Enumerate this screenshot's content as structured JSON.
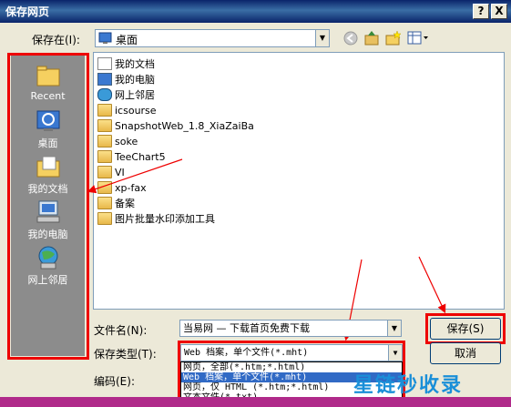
{
  "window": {
    "title": "保存网页",
    "help_glyph": "?",
    "close_glyph": "X"
  },
  "save_in": {
    "label": "保存在(I):",
    "value": "桌面"
  },
  "places": [
    {
      "label": "Recent",
      "icon": "recent-folder-icon"
    },
    {
      "label": "桌面",
      "icon": "desktop-icon"
    },
    {
      "label": "我的文档",
      "icon": "my-documents-icon"
    },
    {
      "label": "我的电脑",
      "icon": "my-computer-icon"
    },
    {
      "label": "网上邻居",
      "icon": "network-places-icon"
    }
  ],
  "files": [
    {
      "name": "我的文档",
      "icon": "my-documents-icon"
    },
    {
      "name": "我的电脑",
      "icon": "my-computer-icon"
    },
    {
      "name": "网上邻居",
      "icon": "network-places-icon"
    },
    {
      "name": "icsourse",
      "icon": "folder-icon"
    },
    {
      "name": "SnapshotWeb_1.8_XiaZaiBa",
      "icon": "folder-icon"
    },
    {
      "name": "soke",
      "icon": "folder-icon"
    },
    {
      "name": "TeeChart5",
      "icon": "folder-icon"
    },
    {
      "name": "VI",
      "icon": "folder-icon"
    },
    {
      "name": "xp-fax",
      "icon": "folder-icon"
    },
    {
      "name": "备案",
      "icon": "folder-icon"
    },
    {
      "name": "图片批量水印添加工具",
      "icon": "folder-icon"
    }
  ],
  "filename": {
    "label": "文件名(N):",
    "value": "当易网 — 下载首页免费下载"
  },
  "save_type": {
    "label": "保存类型(T):",
    "value": "Web 档案，单个文件(*.mht)",
    "options": [
      "网页，全部(*.htm;*.html)",
      "Web 档案，单个文件(*.mht)",
      "网页，仅 HTML (*.htm;*.html)",
      "文本文件(*.txt)"
    ],
    "selected_index": 1
  },
  "encoding": {
    "label": "编码(E):"
  },
  "buttons": {
    "save": "保存(S)",
    "cancel": "取消"
  },
  "watermark": "星链秒收录",
  "colors": {
    "highlight_red": "#e00000",
    "selection_blue": "#316ac5",
    "places_bg": "#8c8c8c"
  }
}
